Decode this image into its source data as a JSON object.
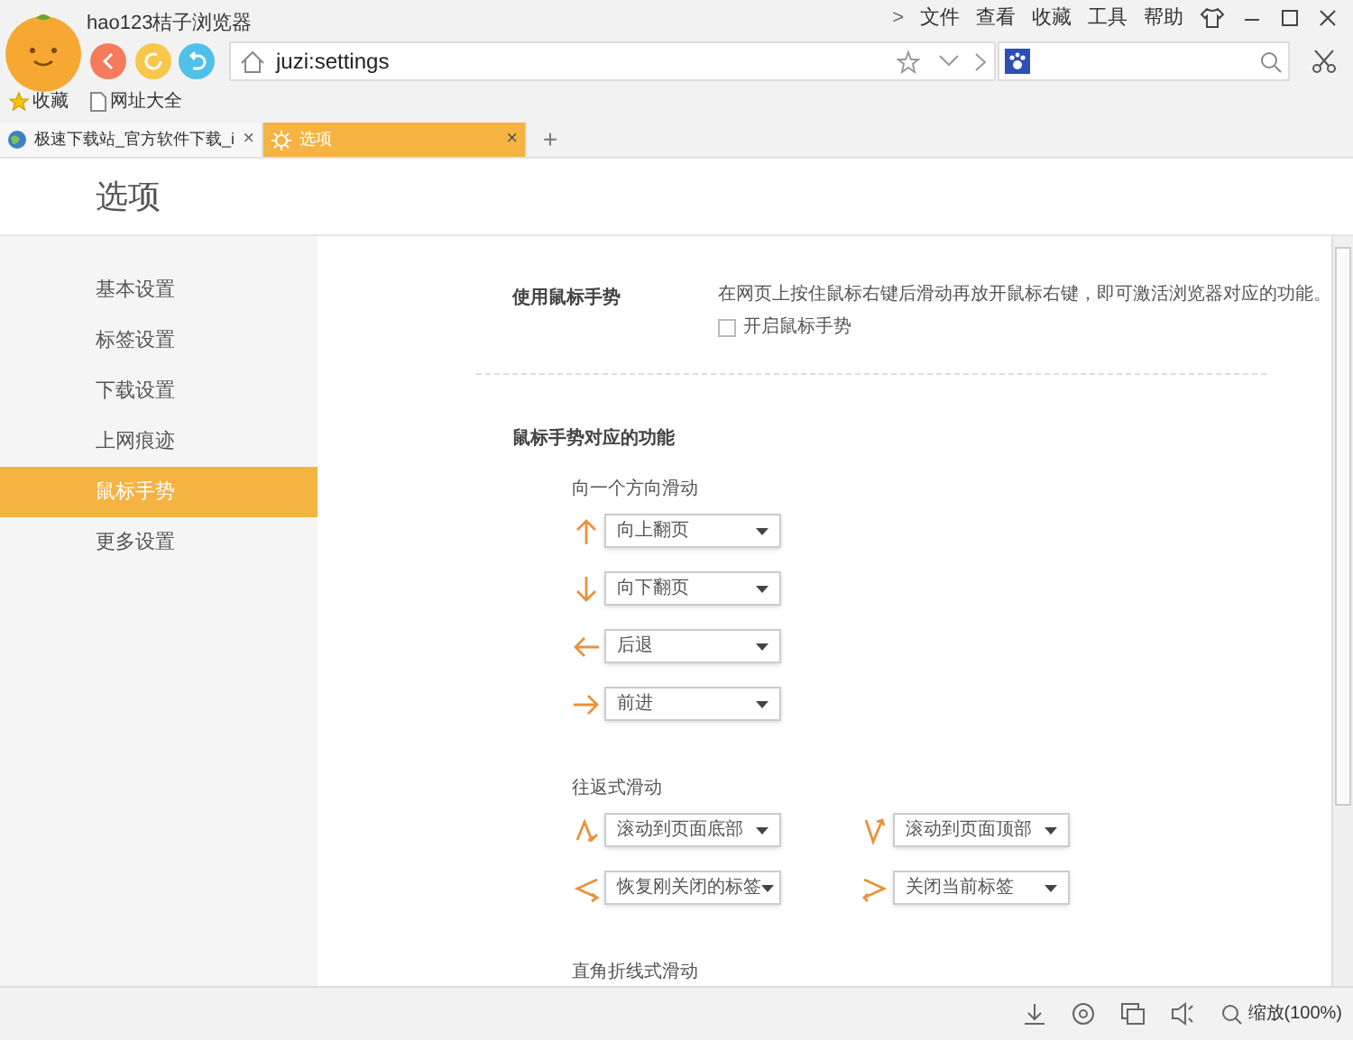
{
  "window": {
    "title": "hao123桔子浏览器"
  },
  "menu_chevron": ">",
  "menu": [
    "文件",
    "查看",
    "收藏",
    "工具",
    "帮助"
  ],
  "address_bar": {
    "value": "juzi:settings"
  },
  "bookmarks": [
    {
      "label": "收藏",
      "kind": "star"
    },
    {
      "label": "网址大全",
      "kind": "page"
    }
  ],
  "tabs": [
    {
      "label": "极速下载站_官方软件下载_i",
      "selected": false,
      "close": "×"
    },
    {
      "label": "选项",
      "selected": true,
      "close": "×"
    }
  ],
  "new_tab": "+",
  "page_title": "选项",
  "sidebar": {
    "items": [
      {
        "label": "基本设置",
        "selected": false
      },
      {
        "label": "标签设置",
        "selected": false
      },
      {
        "label": "下载设置",
        "selected": false
      },
      {
        "label": "上网痕迹",
        "selected": false
      },
      {
        "label": "鼠标手势",
        "selected": true
      },
      {
        "label": "更多设置",
        "selected": false
      }
    ]
  },
  "gesture_setting": {
    "label": "使用鼠标手势",
    "description": "在网页上按住鼠标右键后滑动再放开鼠标右键，即可激活浏览器对应的功能。",
    "checkbox": {
      "label": "开启鼠标手势",
      "checked": false
    }
  },
  "functions": {
    "title": "鼠标手势对应的功能",
    "groups": [
      {
        "title": "向一个方向滑动",
        "rows": [
          [
            {
              "kind": "up",
              "value": "向上翻页"
            }
          ],
          [
            {
              "kind": "down",
              "value": "向下翻页"
            }
          ],
          [
            {
              "kind": "left",
              "value": "后退"
            }
          ],
          [
            {
              "kind": "right",
              "value": "前进"
            }
          ]
        ]
      },
      {
        "title": "往返式滑动",
        "rows": [
          [
            {
              "kind": "downup",
              "value": "滚动到页面底部"
            },
            {
              "kind": "updown",
              "value": "滚动到页面顶部"
            }
          ],
          [
            {
              "kind": "leftright",
              "value": "恢复刚关闭的标签"
            },
            {
              "kind": "rightleft",
              "value": "关闭当前标签"
            }
          ]
        ]
      },
      {
        "title": "直角折线式滑动"
      }
    ]
  },
  "status_bar": {
    "zoom": "缩放(100%)"
  }
}
